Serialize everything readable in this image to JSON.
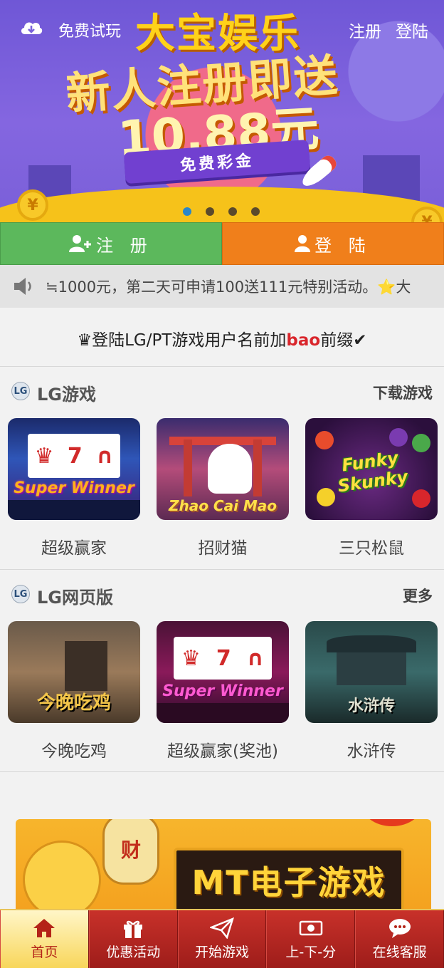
{
  "topbar": {
    "trial_label": "免费试玩",
    "register_label": "注册",
    "login_label": "登陆"
  },
  "banner": {
    "brand": "大宝娱乐",
    "promo": "新人注册即送",
    "amount": "10.88元",
    "ribbon": "免费彩金",
    "slides": 4,
    "active_slide": 1
  },
  "auth": {
    "register_label": "注 册",
    "login_label": "登 陆"
  },
  "notice": {
    "text": "≒1000元，第二天可申请100送111元特别活动。",
    "star": "⭐",
    "tail": "大"
  },
  "prefix_notice": {
    "crown": "♛",
    "before": "登陆LG/PT游戏用户名前加",
    "highlight": "bao",
    "after": "前缀",
    "check": "✔"
  },
  "sections": [
    {
      "title": "LG游戏",
      "logo": "LG",
      "more_label": "下载游戏",
      "games": [
        {
          "name": "超级赢家",
          "art_label": "Super Winner"
        },
        {
          "name": "招财猫",
          "art_label": "Zhao Cai Mao"
        },
        {
          "name": "三只松鼠",
          "art_label": "Funky Skunky"
        }
      ]
    },
    {
      "title": "LG网页版",
      "logo": "LG",
      "more_label": "更多",
      "games": [
        {
          "name": "今晚吃鸡",
          "art_label": "今晚吃鸡"
        },
        {
          "name": "超级赢家(奖池)",
          "art_label": "Super Winner"
        },
        {
          "name": "水浒传",
          "art_label": "水浒传"
        }
      ]
    }
  ],
  "mt_banner": {
    "title": "MT电子游戏",
    "lantern": "财"
  },
  "nav": {
    "items": [
      {
        "label": "首页",
        "icon": "home-icon",
        "active": true
      },
      {
        "label": "优惠活动",
        "icon": "gift-icon",
        "active": false
      },
      {
        "label": "开始游戏",
        "icon": "paper-plane-icon",
        "active": false
      },
      {
        "label": "上-下-分",
        "icon": "money-bill-icon",
        "active": false
      },
      {
        "label": "在线客服",
        "icon": "chat-icon",
        "active": false
      }
    ]
  },
  "colors": {
    "register_green": "#5cb85c",
    "login_orange": "#f07f1b",
    "nav_red": "#b4231e",
    "highlight_red": "#d9262c"
  }
}
